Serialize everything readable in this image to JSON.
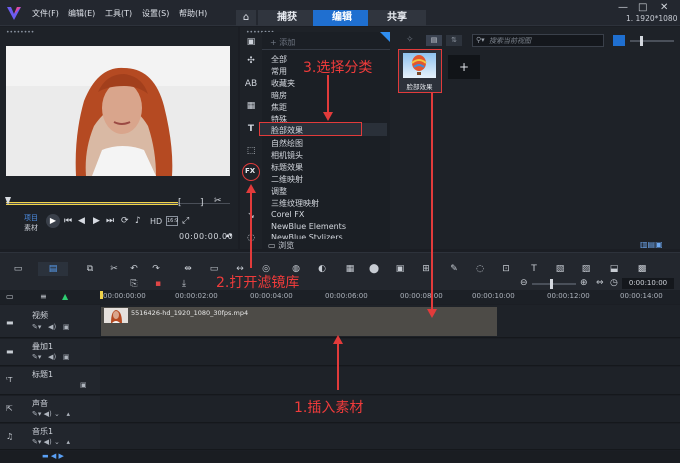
{
  "menu": [
    "文件(F)",
    "编辑(E)",
    "工具(T)",
    "设置(S)",
    "帮助(H)"
  ],
  "tabs": [
    "捕获",
    "编辑",
    "共享"
  ],
  "active_tab": "编辑",
  "resolution": "1. 1920*1080",
  "player": {
    "modes": [
      "项目",
      "素材"
    ],
    "hd": "HD",
    "timecode": "00:00:00.00"
  },
  "library": {
    "add_label": "添加",
    "search_placeholder": "搜索当前视图",
    "categories": [
      "全部",
      "常用",
      "收藏夹",
      "暗房",
      "焦距",
      "特殊",
      "脸部效果",
      "自然绘图",
      "相机镜头",
      "标题效果",
      "二维映射",
      "调整",
      "三维纹理映射",
      "Corel FX",
      "NewBlue Elements",
      "NewBlue Stylizers"
    ],
    "selected_category": "脸部效果",
    "browse": "浏览",
    "effect_item": "脸部效果",
    "fx_label": "FX"
  },
  "ruler_times": [
    "00:00:00:00",
    "00:00:02:00",
    "00:00:04:00",
    "00:00:06:00",
    "00:00:08:00",
    "00:00:10:00",
    "00:00:12:00",
    "00:00:14:00"
  ],
  "zoom_time": "0:00:10:00",
  "tracks": [
    {
      "name": "视频"
    },
    {
      "name": "叠加1"
    },
    {
      "name": "标题1"
    },
    {
      "name": "声音"
    },
    {
      "name": "音乐1"
    }
  ],
  "clip_name": "5516426-hd_1920_1080_30fps.mp4",
  "annotations": {
    "step1": "1.插入素材",
    "step2": "2.打开滤镜库",
    "step3": "3.选择分类"
  },
  "colors": {
    "accent": "#1f6fd0",
    "annotation": "#e23b3b",
    "clip": "#4d4b47"
  }
}
